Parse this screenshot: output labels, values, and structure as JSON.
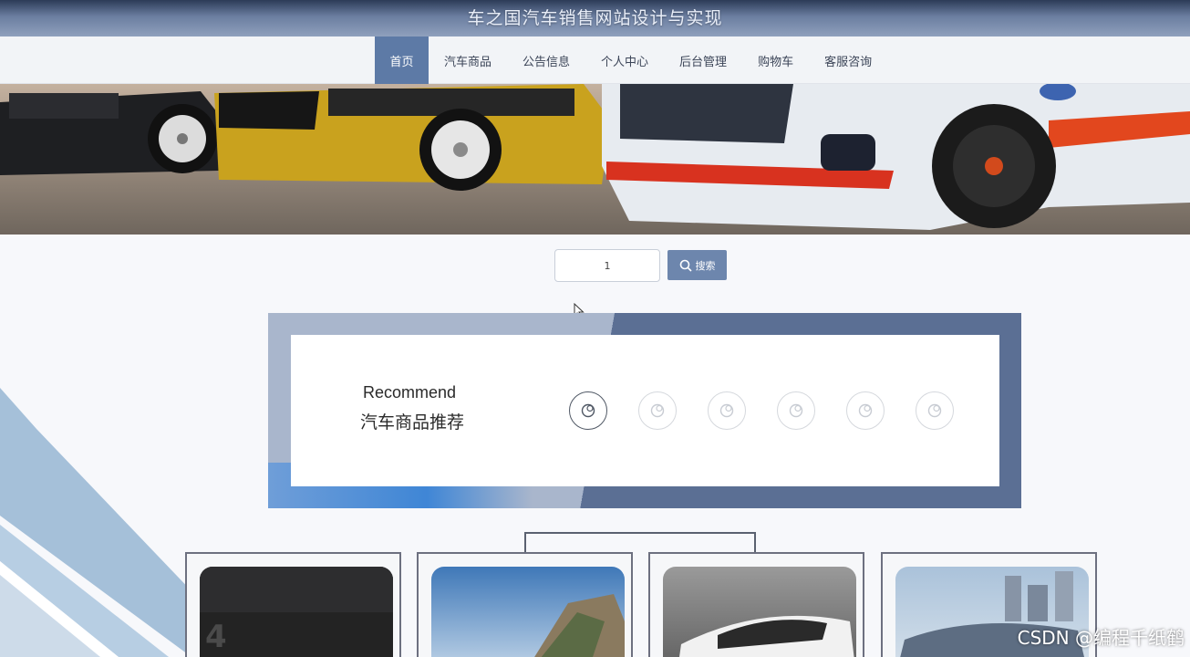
{
  "header": {
    "site_title": "车之国汽车销售网站设计与实现"
  },
  "nav": {
    "items": [
      {
        "label": "首页",
        "active": true
      },
      {
        "label": "汽车商品",
        "active": false
      },
      {
        "label": "公告信息",
        "active": false
      },
      {
        "label": "个人中心",
        "active": false
      },
      {
        "label": "后台管理",
        "active": false
      },
      {
        "label": "购物车",
        "active": false
      },
      {
        "label": "客服咨询",
        "active": false
      }
    ]
  },
  "search": {
    "value": "1",
    "button_label": "搜索"
  },
  "recommend": {
    "title_en": "Recommend",
    "title_cn": "汽车商品推荐",
    "active_index": 0,
    "dot_count": 6
  },
  "watermark": "CSDN @编程千纸鹤",
  "colors": {
    "primary": "#5d7aa6",
    "title_bar": "#6b7ea0",
    "frame_dark": "#5b6f94",
    "frame_light": "#a9b6cc"
  }
}
